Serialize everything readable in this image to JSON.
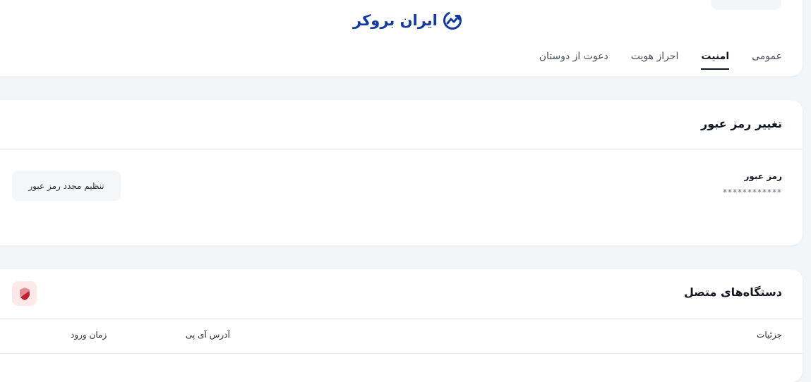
{
  "brand": {
    "logo_text": "ایران بروکر",
    "logo_color": "#123aa6"
  },
  "tabs": [
    {
      "label": "عمومی",
      "active": false
    },
    {
      "label": "امنیت",
      "active": true
    },
    {
      "label": "احراز هویت",
      "active": false
    },
    {
      "label": "دعوت از دوستان",
      "active": false
    }
  ],
  "password_section": {
    "title": "تغییر رمز عبور",
    "field_label": "رمز عبور",
    "masked_value": "************",
    "reset_button": "تنظیم مجدد رمز عبور"
  },
  "devices_section": {
    "title": "دستگاه‌های متصل",
    "action_icon": "shield-icon",
    "columns": {
      "details": "جزئیات",
      "ip": "آدرس آی پی",
      "login_time": "زمان ورود"
    }
  },
  "colors": {
    "background": "#f3f6f9",
    "card": "#ffffff",
    "shield_bg": "#fde8ea",
    "shield_fg": "#c0202e"
  }
}
